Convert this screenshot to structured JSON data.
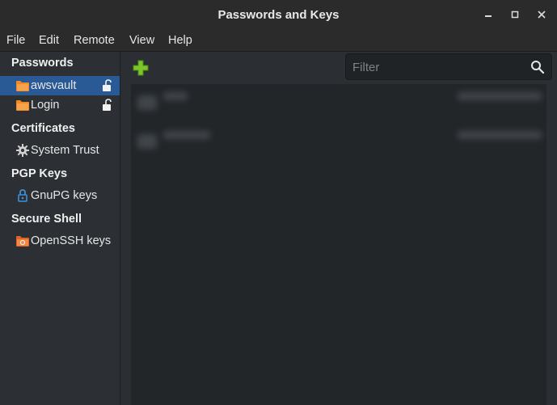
{
  "window": {
    "title": "Passwords and Keys"
  },
  "menubar": {
    "items": [
      "File",
      "Edit",
      "Remote",
      "View",
      "Help"
    ]
  },
  "sidebar": {
    "sections": [
      {
        "heading": "Passwords",
        "items": [
          {
            "label": "awsvault",
            "icon": "folder-icon",
            "selected": true,
            "lock": true
          },
          {
            "label": "Login",
            "icon": "folder-icon",
            "selected": false,
            "lock": true
          }
        ]
      },
      {
        "heading": "Certificates",
        "items": [
          {
            "label": "System Trust",
            "icon": "gear-icon",
            "selected": false,
            "lock": false
          }
        ]
      },
      {
        "heading": "PGP Keys",
        "items": [
          {
            "label": "GnuPG keys",
            "icon": "key-lock-icon",
            "selected": false,
            "lock": false
          }
        ]
      },
      {
        "heading": "Secure Shell",
        "items": [
          {
            "label": "OpenSSH keys",
            "icon": "ssh-folder-icon",
            "selected": false,
            "lock": false
          }
        ]
      }
    ]
  },
  "toolbar": {
    "filter_placeholder": "Filter"
  },
  "colors": {
    "accent": "#2a5a96",
    "add": "#6fbf1f",
    "folder": "#f08a24"
  }
}
